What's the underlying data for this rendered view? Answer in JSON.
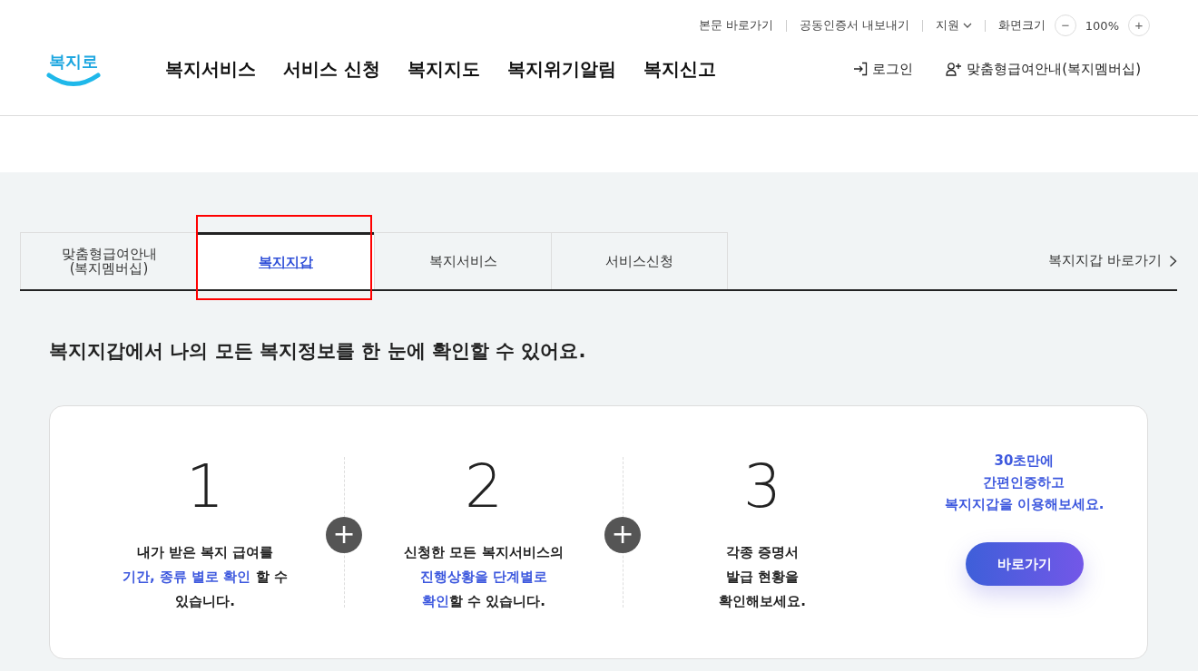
{
  "util_bar": {
    "links": [
      "본문 바로가기",
      "공동인증서 내보내기"
    ],
    "support": "지원",
    "zoom_label": "화면크기",
    "zoom_value": "100%",
    "zoom_out": "−",
    "zoom_in": "+"
  },
  "logo": "복지로",
  "nav": [
    "복지서비스",
    "서비스 신청",
    "복지지도",
    "복지위기알림",
    "복지신고"
  ],
  "account": {
    "login": "로그인",
    "membership": "맞춤형급여안내(복지멤버십)"
  },
  "tabs": [
    {
      "label": "맞춤형급여안내\n(복지멤버십)",
      "selected": false
    },
    {
      "label": "복지지갑",
      "selected": true
    },
    {
      "label": "복지서비스",
      "selected": false
    },
    {
      "label": "서비스신청",
      "selected": false
    }
  ],
  "shortcut": "복지지갑 바로가기",
  "heading": "복지지갑에서 나의 모든 복지정보를 한 눈에 확인할 수 있어요.",
  "steps": [
    {
      "number": "1",
      "parts": [
        {
          "text": "내가 받은 복지 급여를\n",
          "highlight": false
        },
        {
          "text": "기간, 종류 별로 확인",
          "highlight": true
        },
        {
          "text": " 할 수\n있습니다.",
          "highlight": false
        }
      ]
    },
    {
      "number": "2",
      "parts": [
        {
          "text": "신청한 모든 복지서비스의\n",
          "highlight": false
        },
        {
          "text": "진행상황을 단계별로\n확인",
          "highlight": true
        },
        {
          "text": "할 수 있습니다.",
          "highlight": false
        }
      ]
    },
    {
      "number": "3",
      "parts": [
        {
          "text": "각종 증명서\n발급 현황을\n확인해보세요.",
          "highlight": false
        }
      ]
    }
  ],
  "plus_sign": "+",
  "cta": {
    "text": "30초만에\n간편인증하고\n복지지갑을 이용해보세요.",
    "button": "바로가기"
  }
}
